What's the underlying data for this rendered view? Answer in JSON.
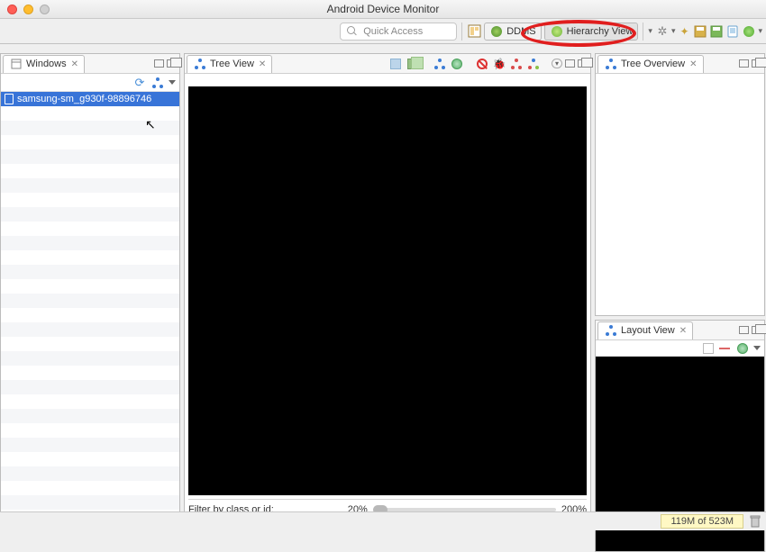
{
  "window": {
    "title": "Android Device Monitor"
  },
  "toolbar": {
    "quick_placeholder": "Quick Access",
    "perspective_ddms": "DDMS",
    "perspective_hierarchy": "Hierarchy View"
  },
  "panes": {
    "windows": {
      "title": "Windows",
      "devices": [
        "samsung-sm_g930f-98896746"
      ]
    },
    "tree_view": {
      "title": "Tree View",
      "filter_label": "Filter by class or id:",
      "zoom_min": "20%",
      "zoom_max": "200%"
    },
    "tree_overview": {
      "title": "Tree Overview"
    },
    "layout_view": {
      "title": "Layout View"
    }
  },
  "status": {
    "heap": "119M of 523M"
  }
}
